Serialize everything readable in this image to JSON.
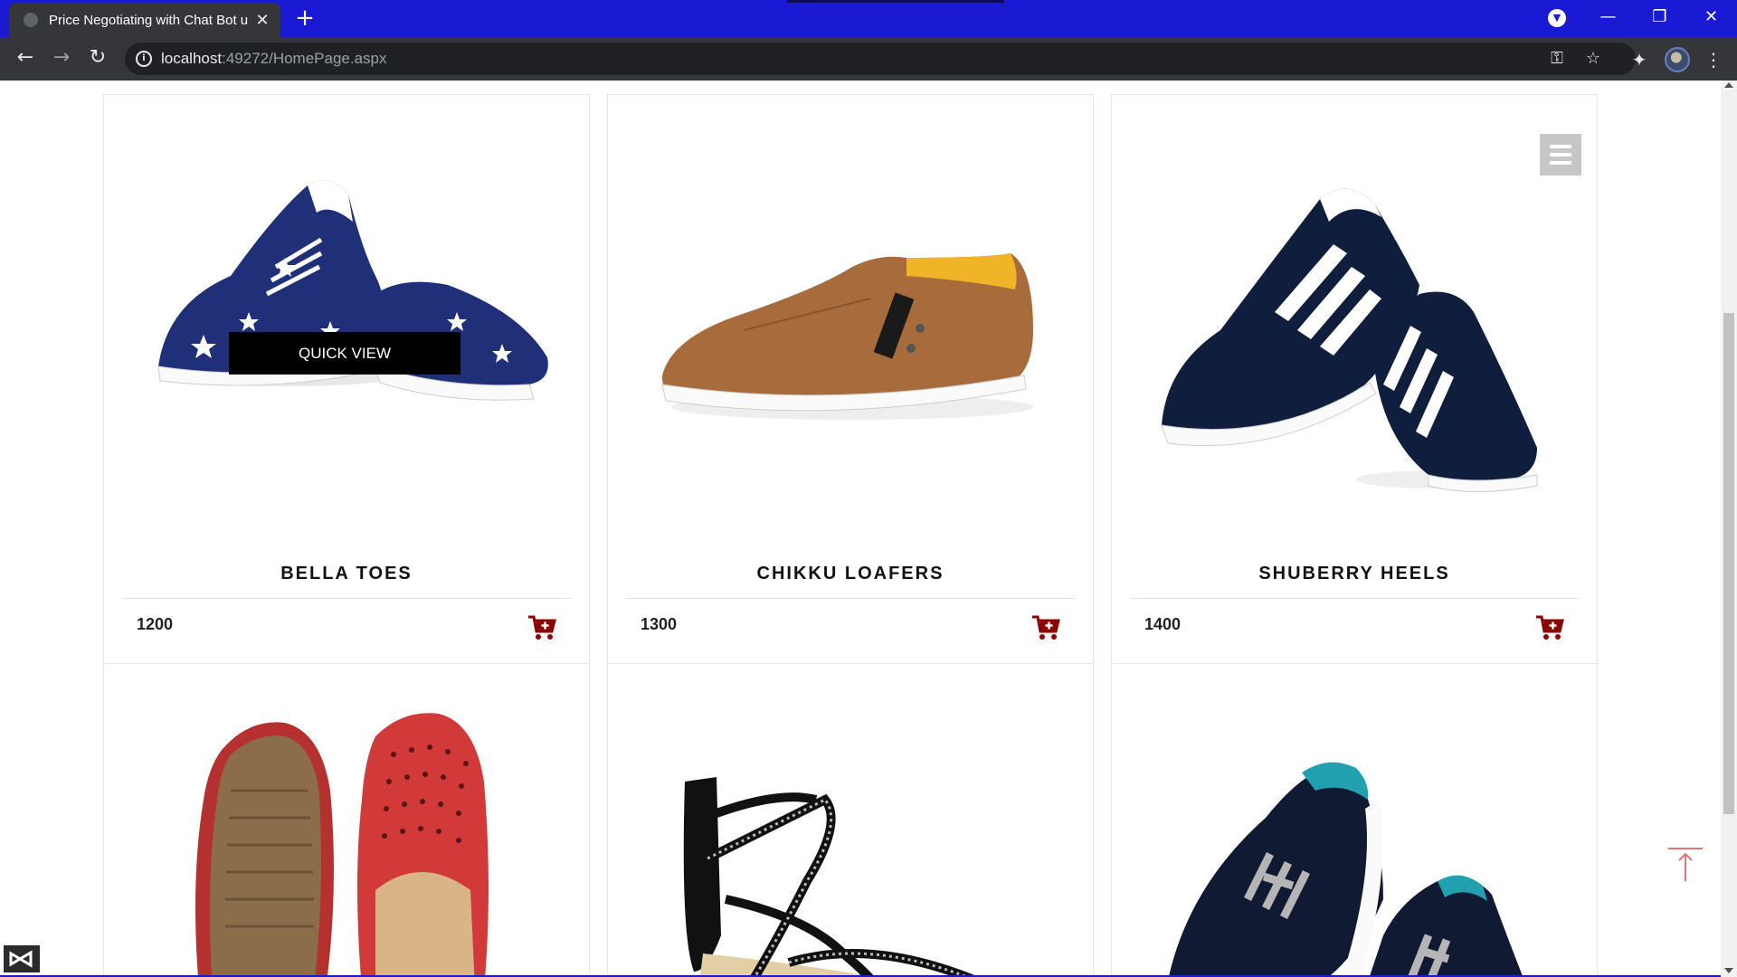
{
  "browser": {
    "tab_title": "Price Negotiating with Chat Bot u",
    "new_tab_icon": "+",
    "url_host": "localhost",
    "url_rest": ":49272/HomePage.aspx"
  },
  "products": [
    {
      "name": "BELLA TOES",
      "price": "1200",
      "image": "star-print-canvas-sneakers"
    },
    {
      "name": "CHIKKU LOAFERS",
      "price": "1300",
      "image": "brown-slip-on-loafer"
    },
    {
      "name": "SHUBERRY HEELS",
      "price": "1400",
      "image": "navy-striped-sneakers"
    },
    {
      "name": "",
      "price": "",
      "image": "red-perforated-bellies"
    },
    {
      "name": "",
      "price": "",
      "image": "black-strappy-sandal"
    },
    {
      "name": "",
      "price": "",
      "image": "navy-teal-sneakers"
    }
  ],
  "quick_view_label": "QUICK VIEW",
  "colors": {
    "tabbar": "#1a1ad4",
    "toolbar": "#35363a",
    "cart_icon": "#8b0000",
    "quick_view_bg": "#000000",
    "to_top_arrow": "#e57373"
  }
}
